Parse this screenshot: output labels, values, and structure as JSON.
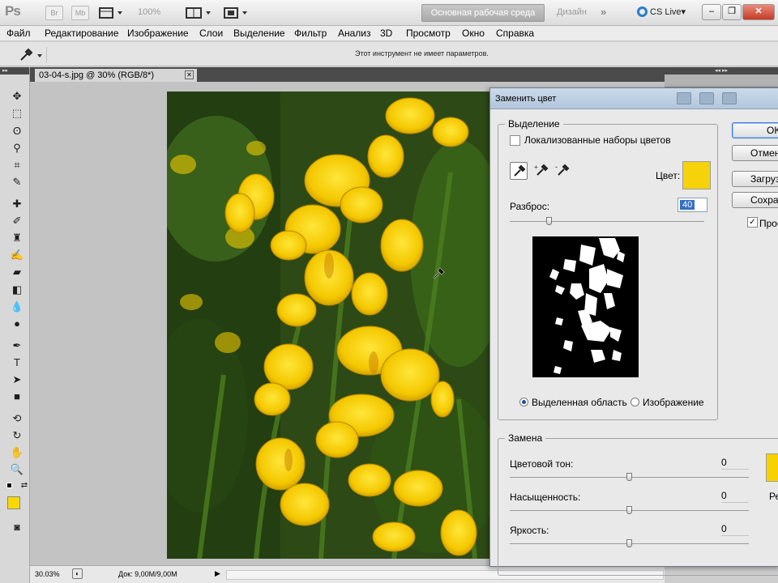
{
  "app": {
    "logo": "Ps",
    "bridge_label": "Br",
    "minibridge_label": "Mb",
    "zoom": "100%",
    "workspace_active": "Основная рабочая среда",
    "workspace_design": "Дизайн",
    "workspace_more": "»",
    "cs_live": "CS Live"
  },
  "menu": [
    "Файл",
    "Редактирование",
    "Изображение",
    "Слои",
    "Выделение",
    "Фильтр",
    "Анализ",
    "3D",
    "Просмотр",
    "Окно",
    "Справка"
  ],
  "options_bar": {
    "hint": "Этот инструмент не имеет параметров."
  },
  "document": {
    "tab_title": "03-04-s.jpg @ 30% (RGB/8*)",
    "status_zoom": "30.03%",
    "status_doc": "Док: 9,00M/9,00M"
  },
  "dialog": {
    "title": "Заменить цвет",
    "selection_group": "Выделение",
    "localized_clusters": "Локализованные наборы цветов",
    "color_label": "Цвет:",
    "fuzziness_label": "Разброс:",
    "fuzziness_value": "40",
    "fuzziness_fraction": 0.2,
    "radio_selection": "Выделенная область",
    "radio_image": "Изображение",
    "replace_group": "Замена",
    "hue_label": "Цветовой тон:",
    "hue_value": "0",
    "saturation_label": "Насыщенность:",
    "saturation_value": "0",
    "lightness_label": "Яркость:",
    "lightness_value": "0",
    "result_label": "Ре",
    "buttons": {
      "ok": "OK",
      "cancel": "Отмена",
      "load": "Загрузить...",
      "save": "Сохранить..."
    },
    "preview_label": "Просмотр"
  },
  "colors": {
    "selected_color": "#f5d20a",
    "foreground": "#f8d800",
    "accent": "#3470c4"
  }
}
